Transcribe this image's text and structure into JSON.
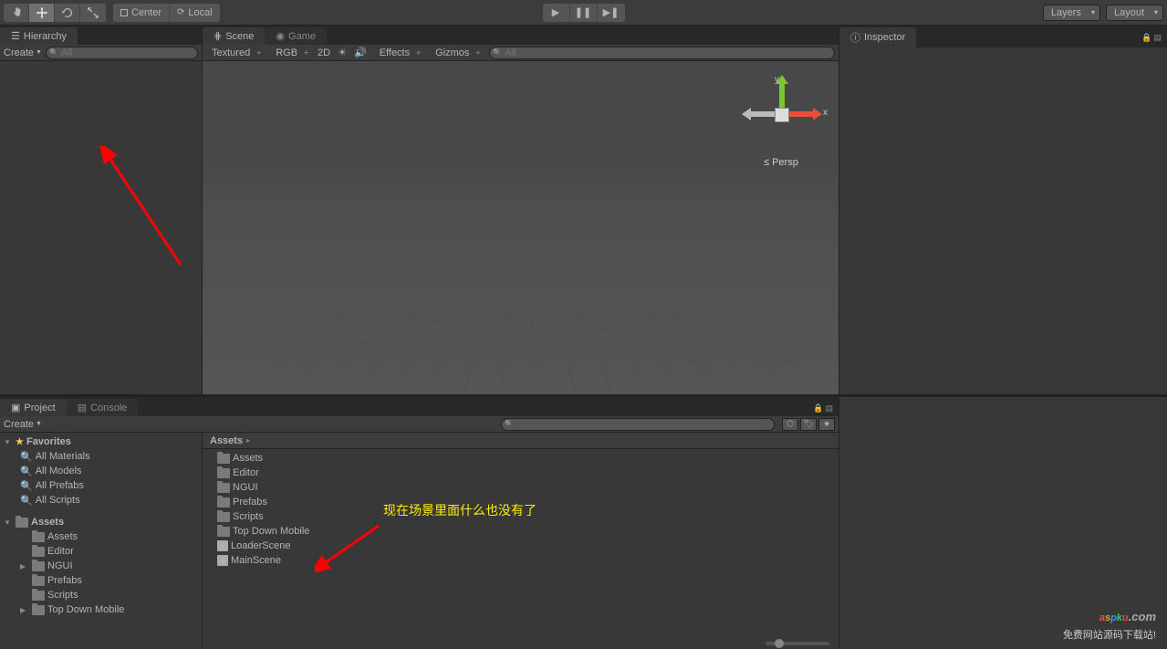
{
  "toolbar": {
    "pivot_center": "Center",
    "pivot_local": "Local",
    "layers": "Layers",
    "layout": "Layout"
  },
  "hierarchy": {
    "tab": "Hierarchy",
    "create": "Create",
    "search_placeholder": "All"
  },
  "scene": {
    "tab_scene": "Scene",
    "tab_game": "Game",
    "shading": "Textured",
    "render": "RGB",
    "mode_2d": "2D",
    "effects": "Effects",
    "gizmos": "Gizmos",
    "search_placeholder": "All",
    "axis_y": "y",
    "axis_x": "x",
    "persp": "Persp"
  },
  "inspector": {
    "tab": "Inspector"
  },
  "project": {
    "tab_project": "Project",
    "tab_console": "Console",
    "create": "Create",
    "favorites_header": "Favorites",
    "favorites": [
      "All Materials",
      "All Models",
      "All Prefabs",
      "All Scripts"
    ],
    "assets_header": "Assets",
    "folders": [
      "Assets",
      "Editor",
      "NGUI",
      "Prefabs",
      "Scripts",
      "Top Down Mobile"
    ],
    "breadcrumb": "Assets",
    "right_items": [
      {
        "type": "folder",
        "name": "Assets"
      },
      {
        "type": "folder",
        "name": "Editor"
      },
      {
        "type": "folder",
        "name": "NGUI"
      },
      {
        "type": "folder",
        "name": "Prefabs"
      },
      {
        "type": "folder",
        "name": "Scripts"
      },
      {
        "type": "folder",
        "name": "Top Down Mobile"
      },
      {
        "type": "scene",
        "name": "LoaderScene"
      },
      {
        "type": "scene",
        "name": "MainScene"
      }
    ]
  },
  "annotations": {
    "text1": "现在场景里面什么也没有了"
  },
  "watermark": {
    "sub": "免费网站源码下载站!"
  }
}
